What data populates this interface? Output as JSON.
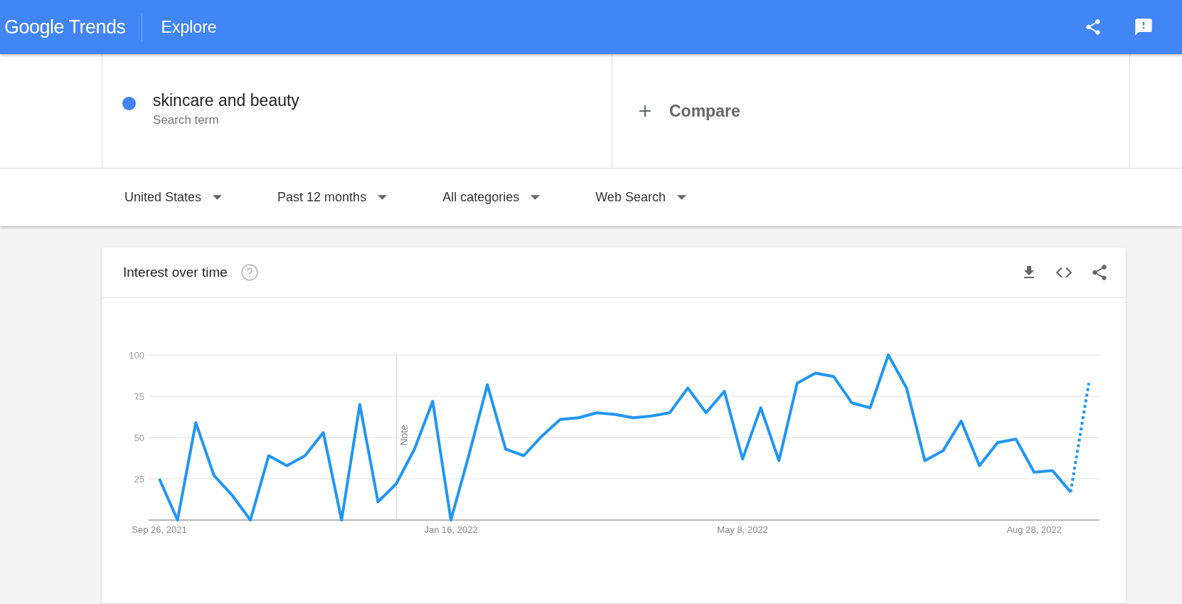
{
  "header": {
    "logo": "Google Trends",
    "section": "Explore"
  },
  "search_terms": [
    {
      "term": "skincare and beauty",
      "caption": "Search term",
      "color": "#4285f4"
    }
  ],
  "compare": {
    "label": "Compare"
  },
  "filters": [
    {
      "label": "United States"
    },
    {
      "label": "Past 12 months"
    },
    {
      "label": "All categories"
    },
    {
      "label": "Web Search"
    }
  ],
  "interest_card": {
    "title": "Interest over time",
    "chart_data": {
      "type": "line",
      "grid": true,
      "ylim": [
        0,
        100
      ],
      "yticks": [
        25,
        50,
        75,
        100
      ],
      "categories": [
        "Sep 26, 2021",
        null,
        null,
        null,
        null,
        null,
        null,
        null,
        null,
        null,
        null,
        null,
        null,
        null,
        null,
        null,
        "Jan 16, 2022",
        null,
        null,
        null,
        null,
        null,
        null,
        null,
        null,
        null,
        null,
        null,
        null,
        null,
        null,
        null,
        "May 8, 2022",
        null,
        null,
        null,
        null,
        null,
        null,
        null,
        null,
        null,
        null,
        null,
        null,
        null,
        null,
        null,
        "Aug 28, 2022",
        null,
        null,
        null
      ],
      "series": [
        {
          "color": "#2196f3",
          "line_style": "solid",
          "values": [
            25,
            0,
            59,
            27,
            15,
            0,
            39,
            33,
            39,
            53,
            0,
            70,
            11,
            22,
            43,
            72,
            0,
            40,
            82,
            43,
            39,
            51,
            61,
            62,
            65,
            64,
            62,
            63,
            65,
            80,
            65,
            78,
            37,
            68,
            36,
            83,
            89,
            87,
            71,
            68,
            100,
            80,
            36,
            42,
            60,
            33,
            47,
            49,
            29,
            30,
            17,
            null
          ]
        },
        {
          "color": "#2196f3",
          "line_style": "dotted",
          "values": [
            null,
            null,
            null,
            null,
            null,
            null,
            null,
            null,
            null,
            null,
            null,
            null,
            null,
            null,
            null,
            null,
            null,
            null,
            null,
            null,
            null,
            null,
            null,
            null,
            null,
            null,
            null,
            null,
            null,
            null,
            null,
            null,
            null,
            null,
            null,
            null,
            null,
            null,
            null,
            null,
            null,
            null,
            null,
            null,
            null,
            null,
            null,
            null,
            null,
            null,
            17,
            83
          ]
        }
      ],
      "annotations": [
        "Note"
      ]
    }
  }
}
